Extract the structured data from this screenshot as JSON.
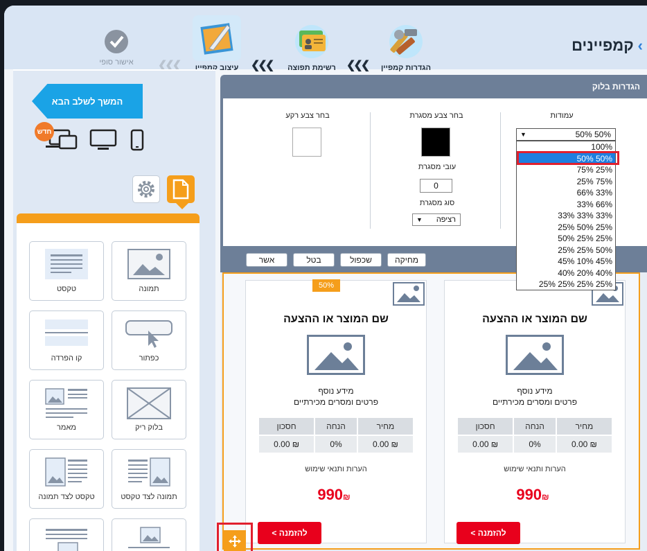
{
  "header": {
    "title": "קמפיינים"
  },
  "steps": [
    {
      "label": "הגדרות קמפיין"
    },
    {
      "label": "רשימת תפוצה"
    },
    {
      "label": "עיצוב קמפיין"
    },
    {
      "label": "אישור סופי"
    }
  ],
  "step_arrows": "❮❮❮",
  "next_button": "המשך לשלב הבא",
  "new_badge": "חדש",
  "palette": {
    "items": [
      {
        "label": "תמונה",
        "icon": "image-icon"
      },
      {
        "label": "טקסט",
        "icon": "text-icon"
      },
      {
        "label": "כפתור",
        "icon": "button-icon"
      },
      {
        "label": "קו הפרדה",
        "icon": "divider-icon"
      },
      {
        "label": "בלוק ריק",
        "icon": "empty-block-icon"
      },
      {
        "label": "מאמר",
        "icon": "article-icon"
      },
      {
        "label": "תמונה לצד טקסט",
        "icon": "image-beside-text-icon"
      },
      {
        "label": "טקסט לצד תמונה",
        "icon": "text-beside-image-icon"
      }
    ]
  },
  "dialog": {
    "title": "הגדרות בלוק",
    "columns_label": "עמודות",
    "columns_selected": "50% 50%",
    "columns_options": [
      "100%",
      "50% 50%",
      "75% 25%",
      "25% 75%",
      "66% 33%",
      "33% 66%",
      "33% 33% 33%",
      "25% 50% 25%",
      "50% 25% 25%",
      "25% 25% 50%",
      "45% 10% 45%",
      "40% 20% 40%",
      "25% 25% 25% 25%"
    ],
    "border_color_label": "בחר צבע מסגרת",
    "border_color": "#000000",
    "border_width_label": "עובי מסגרת",
    "border_width": "0",
    "border_type_label": "סוג מסגרת",
    "border_type": "רציפה",
    "bg_color_label": "בחר צבע רקע",
    "bg_color": "#ffffff",
    "buttons": {
      "delete": "מחיקה",
      "duplicate": "שכפול",
      "cancel": "בטל",
      "confirm": "אשר"
    }
  },
  "column_badge": "50%",
  "products": [
    {
      "name": "שם המוצר או ההצעה",
      "info": "מידע נוסף",
      "details": "פרטים ומסרים מכירתיים",
      "table_headers": [
        "מחיר",
        "הנחה",
        "חסכון"
      ],
      "table_values": [
        "₪ 0.00",
        "0%",
        "₪ 0.00"
      ],
      "terms": "הערות ותנאי שימוש",
      "price": "990",
      "currency": "₪",
      "order": "להזמנה >"
    },
    {
      "name": "שם המוצר או ההצעה",
      "info": "מידע נוסף",
      "details": "פרטים ומסרים מכירתיים",
      "table_headers": [
        "מחיר",
        "הנחה",
        "חסכון"
      ],
      "table_values": [
        "₪ 0.00",
        "0%",
        "₪ 0.00"
      ],
      "terms": "הערות ותנאי שימוש",
      "price": "990",
      "currency": "₪",
      "order": "להזמנה >"
    }
  ]
}
